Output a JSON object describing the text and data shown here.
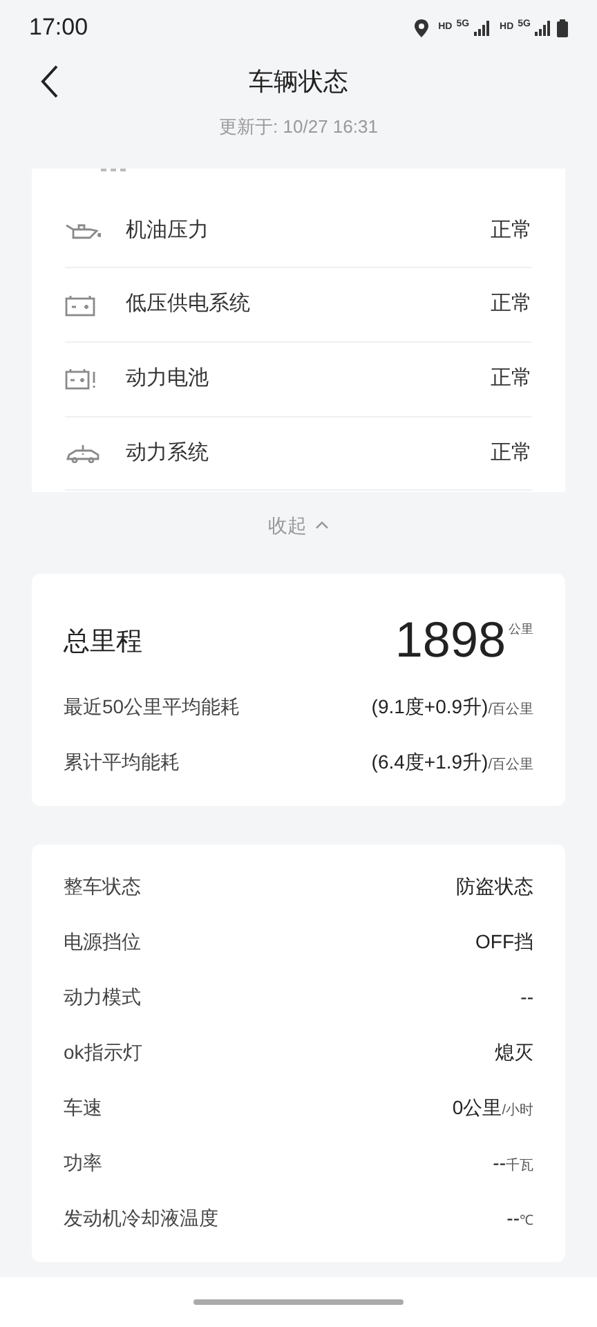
{
  "status_bar": {
    "time": "17:00",
    "sims": [
      {
        "hd": "HD",
        "net": "5G"
      },
      {
        "hd": "HD",
        "net": "5G"
      }
    ]
  },
  "header": {
    "title": "车辆状态",
    "updated": "更新于: 10/27 16:31"
  },
  "checks": [
    {
      "kind": "oil",
      "label": "机油压力",
      "value": "正常"
    },
    {
      "kind": "battery",
      "label": "低压供电系统",
      "value": "正常"
    },
    {
      "kind": "battery-alert",
      "label": "动力电池",
      "value": "正常"
    },
    {
      "kind": "car-alert",
      "label": "动力系统",
      "value": "正常"
    }
  ],
  "collapse": {
    "label": "收起",
    "expanded": true
  },
  "mileage": {
    "label": "总里程",
    "value": "1898",
    "unit": "公里",
    "rows": [
      {
        "label": "最近50公里平均能耗",
        "value": "(9.1度+0.9升)",
        "unit": "/百公里"
      },
      {
        "label": "累计平均能耗",
        "value": "(6.4度+1.9升)",
        "unit": "/百公里"
      }
    ]
  },
  "vehicle": [
    {
      "label": "整车状态",
      "value": "防盗状态"
    },
    {
      "label": "电源挡位",
      "value": "OFF挡"
    },
    {
      "label": "动力模式",
      "value": "--"
    },
    {
      "label": "ok指示灯",
      "value": "熄灭"
    },
    {
      "label": "车速",
      "value": "0公里",
      "unit": "/小时"
    },
    {
      "label": "功率",
      "value": "--",
      "unit": "千瓦"
    },
    {
      "label": "发动机冷却液温度",
      "value": "--",
      "unit": "℃"
    }
  ]
}
